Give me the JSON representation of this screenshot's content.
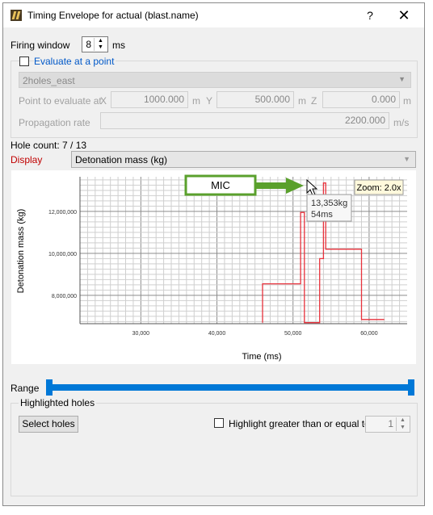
{
  "window": {
    "title": "Timing Envelope for actual (blast.name)",
    "help": "?",
    "close": "✕"
  },
  "firing_window": {
    "label": "Firing window",
    "value": "8",
    "unit": "ms"
  },
  "evaluate": {
    "label": "Evaluate at a point",
    "checked": false,
    "hole_select": "2holes_east",
    "point_label": "Point to evaluate at",
    "x_label": "X",
    "x_value": "1000.000",
    "x_unit": "m",
    "y_label": "Y",
    "y_value": "500.000",
    "y_unit": "m",
    "z_label": "Z",
    "z_value": "0.000",
    "z_unit": "m",
    "prop_label": "Propagation rate",
    "prop_value": "2200.000",
    "prop_unit": "m/s"
  },
  "hole_count": "Hole count: 7 / 13",
  "display": {
    "label": "Display",
    "value": "Detonation mass (kg)"
  },
  "colors": {
    "accent_blue": "#0078d7",
    "display_red": "#c00000",
    "line_red": "#e8323c",
    "annot_green": "#5aa02c"
  },
  "chart_data": {
    "type": "line",
    "xlabel": "Time (ms)",
    "ylabel": "Detonation mass (kg)",
    "x_ticks": [
      "30,000",
      "40,000",
      "50,000",
      "60,000"
    ],
    "y_ticks": [
      "8,000,000",
      "10,000,000",
      "12,000,000"
    ],
    "series": [
      {
        "x": [
          46,
          46,
          51,
          51,
          51.5,
          51.5,
          53.5,
          53.5,
          54,
          54,
          54.3,
          54.3,
          59,
          59,
          62
        ],
        "y": [
          6700000,
          8550000,
          8550000,
          11950000,
          11950000,
          6700000,
          6700000,
          9750000,
          9750000,
          13353000,
          13353000,
          10200000,
          10200000,
          6850000,
          6850000
        ]
      }
    ],
    "annotations": {
      "mic_label": "MIC",
      "tooltip_mass": "13,353kg",
      "tooltip_time": "54ms",
      "zoom": "Zoom: 2.0x"
    }
  },
  "range": {
    "label": "Range"
  },
  "highlighted": {
    "group_label": "Highlighted holes",
    "select_button": "Select holes",
    "highlight_label": "Highlight greater than or equal to",
    "highlight_checked": false,
    "highlight_value": "1"
  }
}
